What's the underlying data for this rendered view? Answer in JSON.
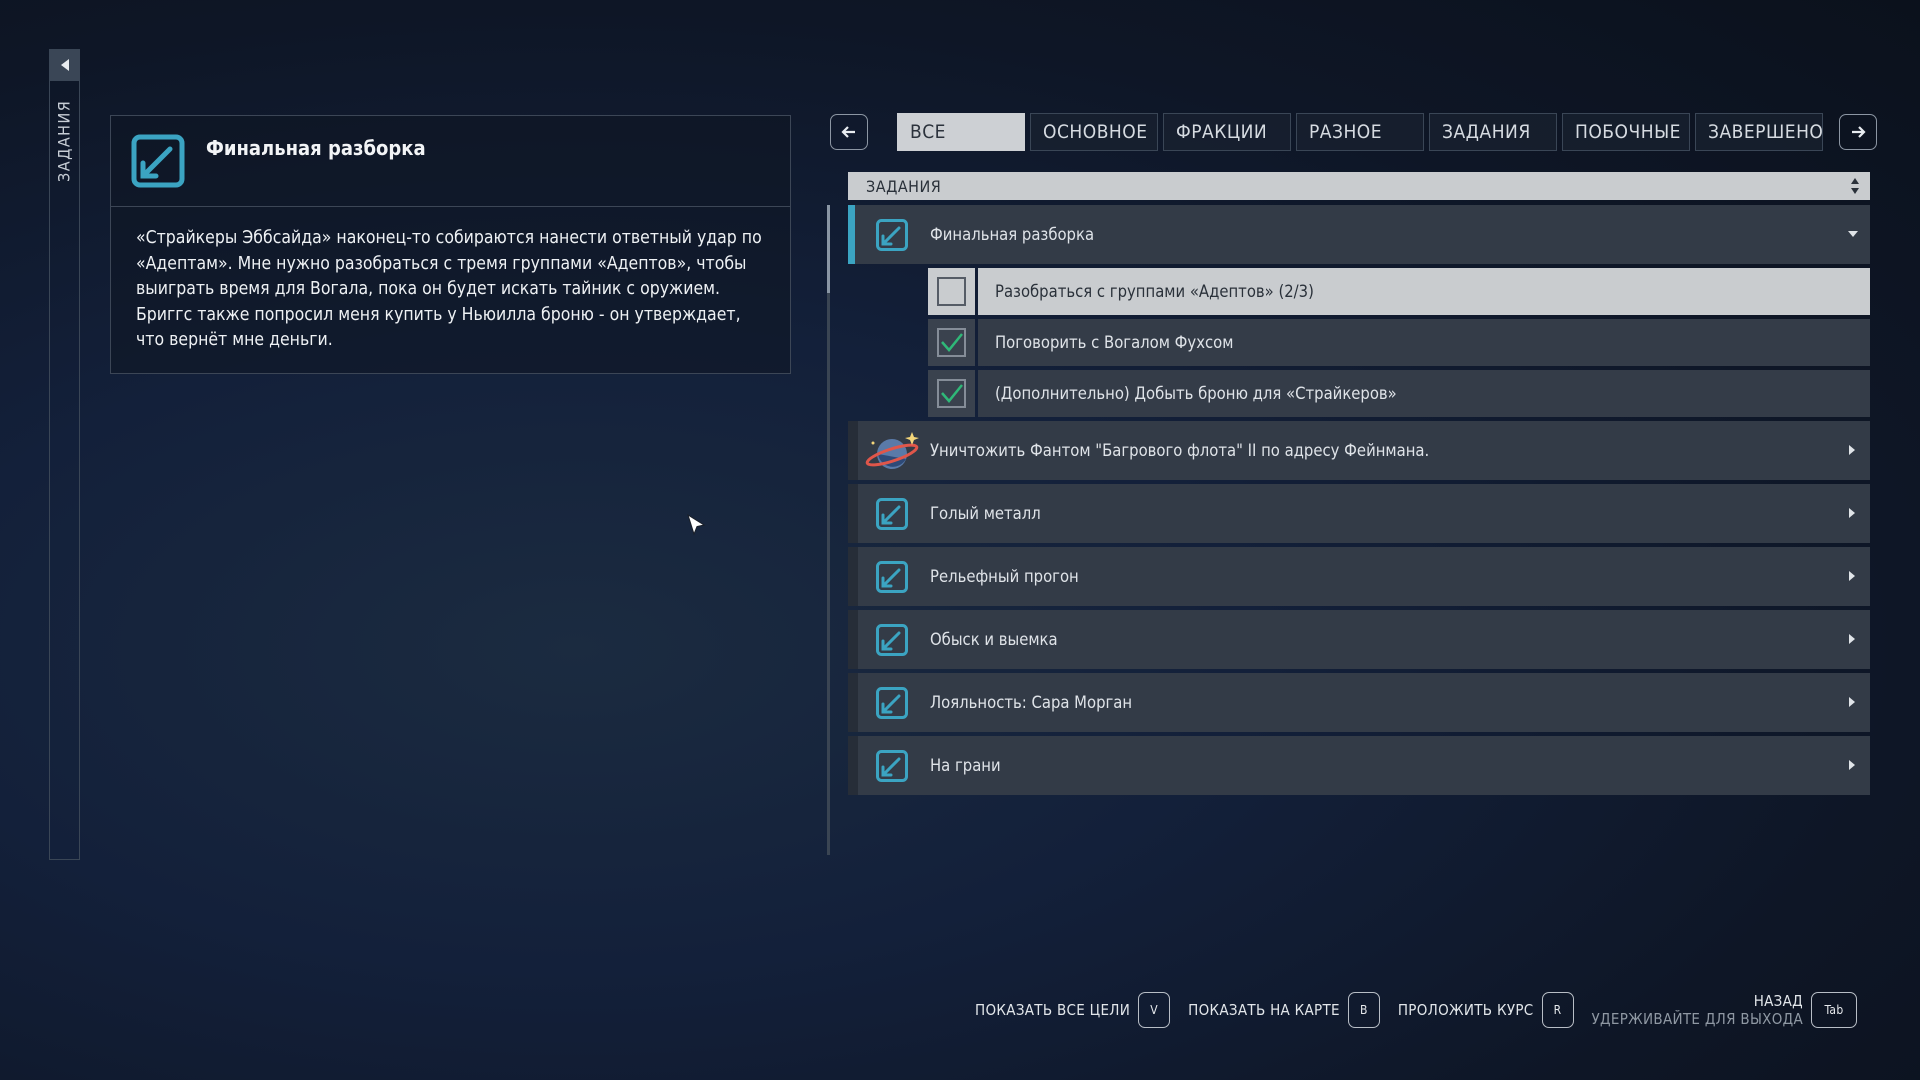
{
  "sidebar": {
    "label": "ЗАДАНИЯ"
  },
  "detail": {
    "title": "Финальная разборка",
    "description": "«Страйкеры Эббсайда» наконец-то собираются нанести ответный удар по «Адептам». Мне нужно разобраться с тремя группами «Адептов», чтобы выиграть время для Вогала, пока он будет искать тайник с оружием. Бриггс также попросил меня купить у Ньюилла броню - он утверждает, что вернёт мне деньги."
  },
  "tabs": [
    {
      "label": "ВСЕ",
      "active": true
    },
    {
      "label": "ОСНОВНОЕ"
    },
    {
      "label": "ФРАКЦИИ"
    },
    {
      "label": "РАЗНОЕ"
    },
    {
      "label": "ЗАДАНИЯ"
    },
    {
      "label": "ПОБОЧНЫЕ"
    },
    {
      "label": "ЗАВЕРШЕНО"
    }
  ],
  "list": {
    "header": "ЗАДАНИЯ",
    "expanded": {
      "title": "Финальная разборка",
      "objectives": [
        {
          "text": "Разобраться с группами «Адептов» (2/3)",
          "done": false,
          "current": true
        },
        {
          "text": "Поговорить с Вогалом Фухсом",
          "done": true
        },
        {
          "text": "(Дополнительно) Добыть броню для «Страйкеров»",
          "done": true
        }
      ]
    },
    "quests": [
      {
        "title": "Уничтожить Фантом \"Багрового флота\" II по адресу Фейнмана.",
        "icon": "planet-icon"
      },
      {
        "title": "Голый металл",
        "icon": "quest-icon"
      },
      {
        "title": "Рельефный прогон",
        "icon": "quest-icon"
      },
      {
        "title": "Обыск и выемка",
        "icon": "quest-icon"
      },
      {
        "title": "Лояльность: Сара Морган",
        "icon": "quest-icon"
      },
      {
        "title": "На грани",
        "icon": "quest-icon"
      }
    ]
  },
  "hints": {
    "show_all": {
      "label": "ПОКАЗАТЬ ВСЕ ЦЕЛИ",
      "key": "V"
    },
    "show_map": {
      "label": "ПОКАЗАТЬ НА КАРТЕ",
      "key": "B"
    },
    "set_course": {
      "label": "ПРОЛОЖИТЬ КУРС",
      "key": "R"
    },
    "back": {
      "label": "НАЗАД",
      "sublabel": "УДЕРЖИВАЙТЕ ДЛЯ ВЫХОДА",
      "key": "Tab"
    }
  },
  "colors": {
    "accent": "#3ba4c2",
    "check": "#2fb878",
    "selected": "#c9cccf"
  }
}
